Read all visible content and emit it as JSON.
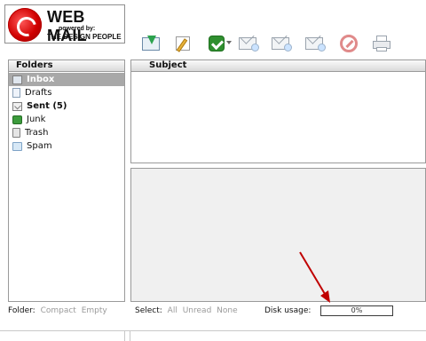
{
  "logo": {
    "title": "WEB MAIL",
    "powered_by": "powered by:",
    "company": "THE DESIGN PEOPLE"
  },
  "toolbar": {
    "icons": [
      "get-mail-icon",
      "compose-icon",
      "check-icon",
      "reply-icon",
      "reply-all-icon",
      "forward-icon",
      "delete-icon",
      "print-icon"
    ]
  },
  "folders": {
    "header": "Folders",
    "items": [
      {
        "label": "Inbox",
        "icon": "inbox-icon",
        "selected": true,
        "bold": true
      },
      {
        "label": "Drafts",
        "icon": "drafts-icon",
        "selected": false,
        "bold": false
      },
      {
        "label": "Sent (5)",
        "icon": "sent-icon",
        "selected": false,
        "bold": true
      },
      {
        "label": "Junk",
        "icon": "junk-icon",
        "selected": false,
        "bold": false
      },
      {
        "label": "Trash",
        "icon": "trash-icon",
        "selected": false,
        "bold": false
      },
      {
        "label": "Spam",
        "icon": "spam-icon",
        "selected": false,
        "bold": false
      }
    ]
  },
  "messages": {
    "subject_header": "Subject"
  },
  "footer": {
    "folder_label": "Folder:",
    "compact": "Compact",
    "empty": "Empty",
    "select_label": "Select:",
    "select_all": "All",
    "select_unread": "Unread",
    "select_none": "None",
    "disk_label": "Disk usage:",
    "disk_value_text": "0%",
    "disk_fraction": 0.0
  },
  "colors": {
    "selected_folder_bg": "#a8a8a8",
    "annotation_arrow": "#c00000",
    "muted_link": "#9a9a9a"
  }
}
